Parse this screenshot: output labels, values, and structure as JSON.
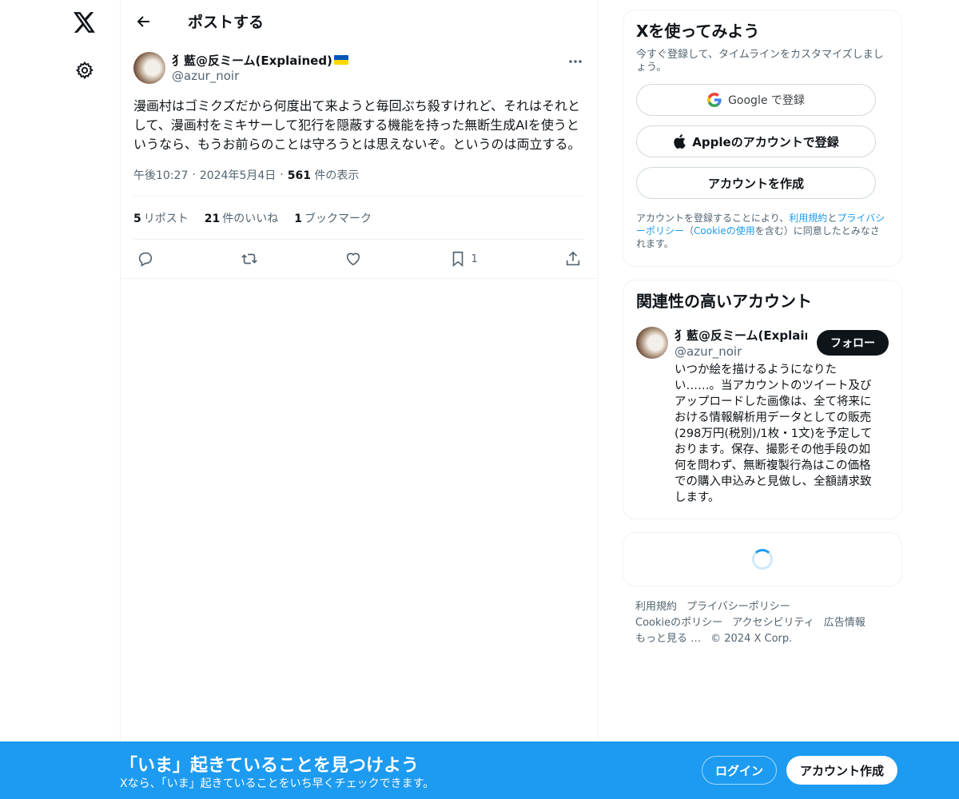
{
  "nav": {
    "logo_icon": "x-logo-icon",
    "settings_icon": "gear-icon"
  },
  "header": {
    "title": "ポストする"
  },
  "post": {
    "display_name": "犭藍@反ミーム(Explained)",
    "handle": "@azur_noir",
    "text": "漫画村はゴミクズだから何度出て来ようと毎回ぶち殺すけれど、それはそれとして、漫画村をミキサーして犯行を隠蔽する機能を持った無断生成AIを使うというなら、もうお前らのことは守ろうとは思えないぞ。というのは両立する。",
    "time": "午後10:27",
    "date": "2024年5月4日",
    "views_count": "561",
    "views_label": "件の表示",
    "reposts_count": "5",
    "reposts_label": "リポスト",
    "likes_count": "21",
    "likes_label": "件のいいね",
    "bookmarks_count": "1",
    "bookmarks_label": "ブックマーク",
    "bookmark_action_count": "1"
  },
  "signup": {
    "title": "Xを使ってみよう",
    "subtitle": "今すぐ登録して、タイムラインをカスタマイズしましょう。",
    "google_button": "Google で登録",
    "apple_button": "Appleのアカウントで登録",
    "create_button": "アカウントを作成",
    "legal_prefix": "アカウントを登録することにより、",
    "terms_link": "利用規約",
    "legal_and": "と",
    "privacy_link": "プライバシーポリシー",
    "legal_paren_open": "（",
    "cookie_link": "Cookieの使用",
    "legal_suffix": "を含む）に同意したとみなされます。"
  },
  "related": {
    "title": "関連性の高いアカウント",
    "name": "犭藍@反ミーム(Explained)",
    "handle": "@azur_noir",
    "follow_button": "フォロー",
    "bio": "いつか絵を描けるようになりたい……。当アカウントのツイート及びアップロードした画像は、全て将来における情報解析用データとしての販売(298万円(税別)/1枚・1文)を予定しております。保存、撮影その他手段の如何を問わず、無断複製行為はこの価格での購入申込みと見做し、全額請求致します。"
  },
  "footer": {
    "terms": "利用規約",
    "privacy": "プライバシーポリシー",
    "cookie": "Cookieのポリシー",
    "accessibility": "アクセシビリティ",
    "ads": "広告情報",
    "more": "もっと見る …",
    "copyright": "© 2024 X Corp."
  },
  "bottombar": {
    "title": "「いま」起きていることを見つけよう",
    "subtitle": "Xなら、「いま」起きていることをいち早くチェックできます。",
    "login_button": "ログイン",
    "signup_button": "アカウント作成"
  },
  "colors": {
    "accent": "#1d9bf0",
    "text": "#0f1419",
    "muted": "#536471",
    "border": "#eff3f4"
  }
}
